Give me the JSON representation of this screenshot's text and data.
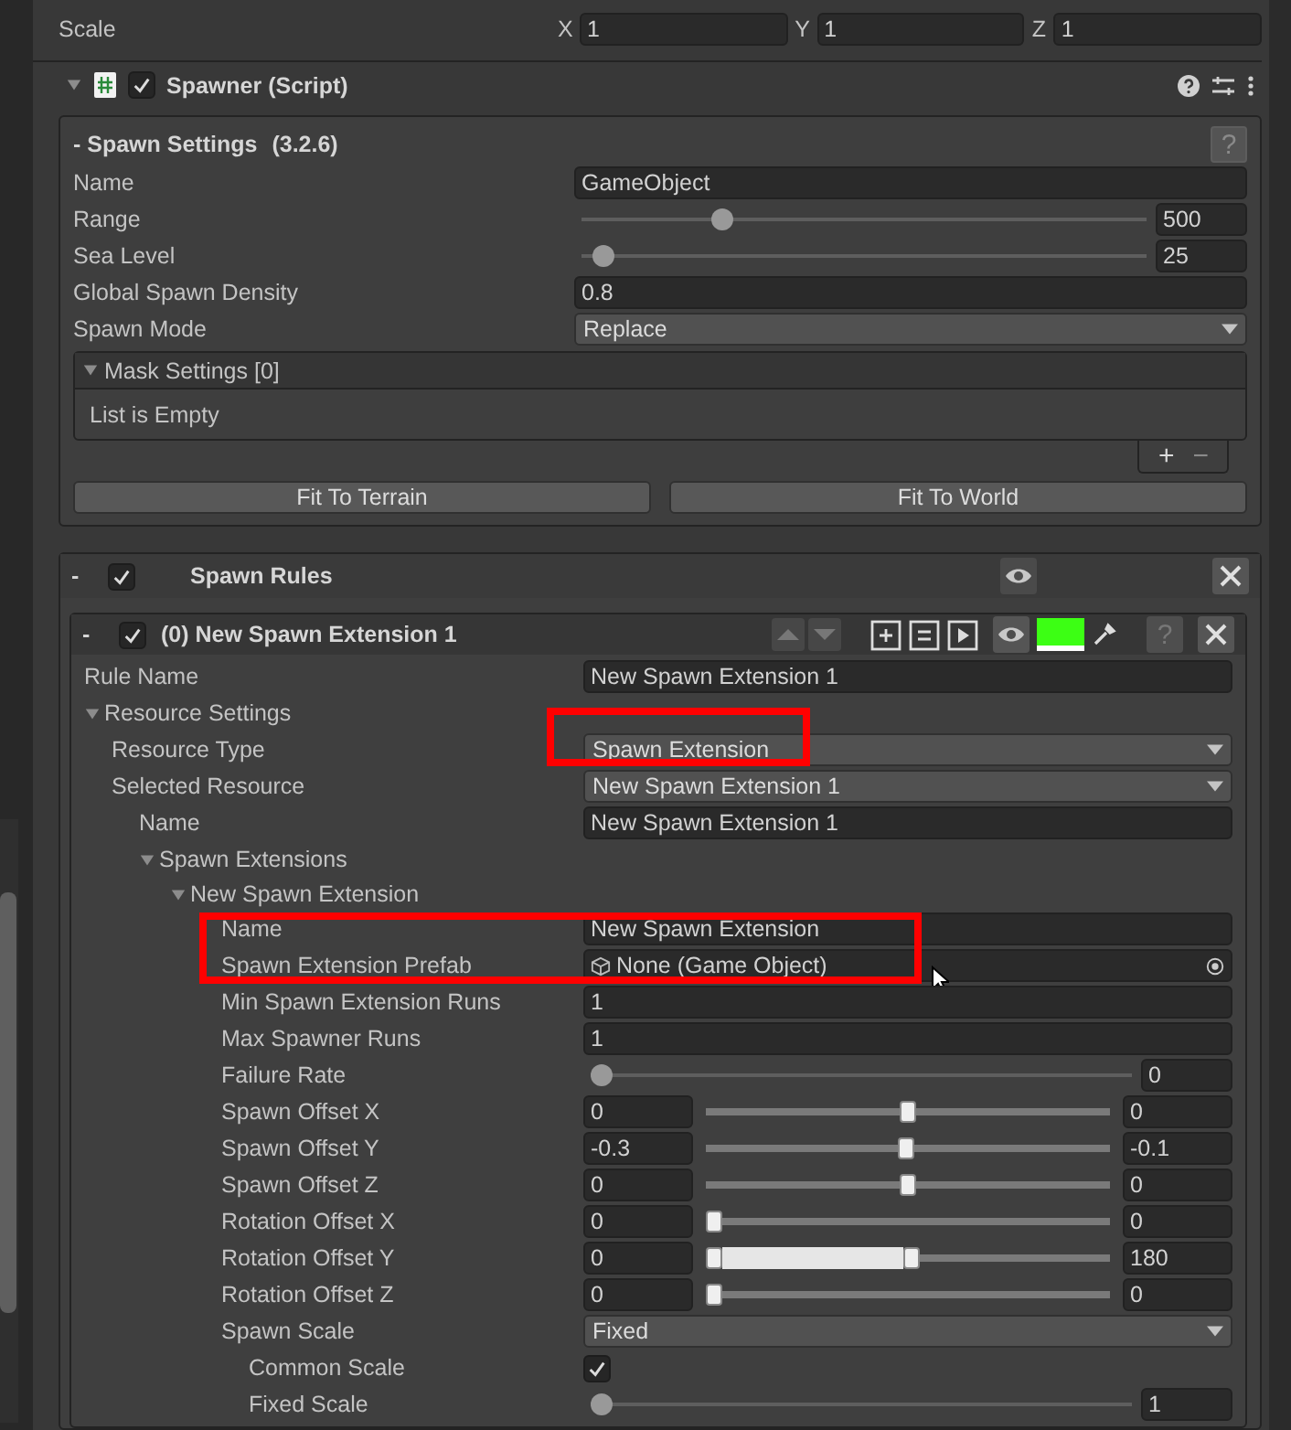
{
  "transform": {
    "label": "Scale",
    "axes": [
      {
        "axis": "X",
        "value": "1"
      },
      {
        "axis": "Y",
        "value": "1"
      },
      {
        "axis": "Z",
        "value": "1"
      }
    ]
  },
  "component": {
    "title": "Spawner (Script)",
    "expanded": true,
    "enabled": true
  },
  "spawn_settings": {
    "title": "- Spawn Settings",
    "version": "(3.2.6)",
    "help": "?",
    "fields": [
      {
        "kind": "text",
        "label": "Name",
        "value": "GameObject"
      },
      {
        "kind": "slider",
        "label": "Range",
        "level": 0.24,
        "value": "500"
      },
      {
        "kind": "slider",
        "label": "Sea Level",
        "level": 0.02,
        "value": "25"
      },
      {
        "kind": "text",
        "label": "Global Spawn Density",
        "value": "0.8"
      },
      {
        "kind": "dropdown",
        "label": "Spawn Mode",
        "value": "Replace"
      }
    ],
    "mask_list": {
      "title": "Mask Settings [0]",
      "expanded": true,
      "empty_text": "List is Empty",
      "add": "+",
      "remove": "−"
    },
    "buttons": [
      "Fit To Terrain",
      "Fit To World"
    ]
  },
  "spawn_rules": {
    "collapse": "-",
    "enabled": true,
    "title": "Spawn Rules",
    "rules": [
      {
        "collapse": "-",
        "enabled": true,
        "title": "(0) New Spawn Extension 1",
        "color": "#3cff14",
        "help": "?",
        "fields": [
          {
            "kind": "text",
            "label": "Rule Name",
            "value": "New Spawn Extension 1"
          },
          {
            "kind": "foldout",
            "label": "Resource Settings",
            "expanded": true,
            "children": [
              {
                "kind": "dropdown",
                "label": "Resource Type",
                "value": "Spawn Extension",
                "highlighted": true
              },
              {
                "kind": "dropdown",
                "label": "Selected Resource",
                "value": "New Spawn Extension 1",
                "children": [
                  {
                    "kind": "text",
                    "label": "Name",
                    "value": "New Spawn Extension 1"
                  },
                  {
                    "kind": "foldout",
                    "label": "Spawn Extensions",
                    "expanded": true,
                    "children": [
                      {
                        "kind": "foldout",
                        "label": "New Spawn Extension",
                        "expanded": true,
                        "children": [
                          {
                            "kind": "text",
                            "label": "Name",
                            "value": "New Spawn Extension"
                          },
                          {
                            "kind": "object",
                            "label": "Spawn Extension Prefab",
                            "value": "None (Game Object)",
                            "highlighted": true,
                            "cursor": true
                          },
                          {
                            "kind": "text",
                            "label": "Min Spawn Extension Runs",
                            "value": "1"
                          },
                          {
                            "kind": "text",
                            "label": "Max Spawner Runs",
                            "value": "1"
                          },
                          {
                            "kind": "slider",
                            "label": "Failure Rate",
                            "level": 0,
                            "value": "0"
                          },
                          {
                            "kind": "minmax",
                            "label": "Spawn Offset X",
                            "min": "0",
                            "max": "0",
                            "handles": [
                              {
                                "level": 0.5
                              },
                              {
                                "level": 0.5
                              }
                            ]
                          },
                          {
                            "kind": "minmax",
                            "label": "Spawn Offset Y",
                            "min": "-0.3",
                            "max": "-0.1",
                            "handles": [
                              {
                                "level": 0.49
                              },
                              {
                                "level": 0.5
                              }
                            ]
                          },
                          {
                            "kind": "minmax",
                            "label": "Spawn Offset Z",
                            "min": "0",
                            "max": "0",
                            "handles": [
                              {
                                "level": 0.5
                              },
                              {
                                "level": 0.5
                              }
                            ]
                          },
                          {
                            "kind": "minmax",
                            "label": "Rotation Offset X",
                            "min": "0",
                            "max": "0",
                            "handles": [
                              {
                                "level": 0
                              },
                              {
                                "level": 0
                              }
                            ]
                          },
                          {
                            "kind": "minmax",
                            "label": "Rotation Offset Y",
                            "min": "0",
                            "max": "180",
                            "handles": [
                              {
                                "level": 0
                              },
                              {
                                "level": 0.51
                              }
                            ]
                          },
                          {
                            "kind": "minmax",
                            "label": "Rotation Offset Z",
                            "min": "0",
                            "max": "0",
                            "handles": [
                              {
                                "level": 0
                              },
                              {
                                "level": 0
                              }
                            ]
                          },
                          {
                            "kind": "dropdown",
                            "label": "Spawn Scale",
                            "value": "Fixed",
                            "children": [
                              {
                                "kind": "checkbox",
                                "label": "Common Scale",
                                "checked": true
                              },
                              {
                                "kind": "slider",
                                "label": "Fixed Scale",
                                "level": 0,
                                "value": "1"
                              }
                            ]
                          }
                        ]
                      }
                    ]
                  }
                ]
              }
            ]
          }
        ]
      }
    ]
  }
}
